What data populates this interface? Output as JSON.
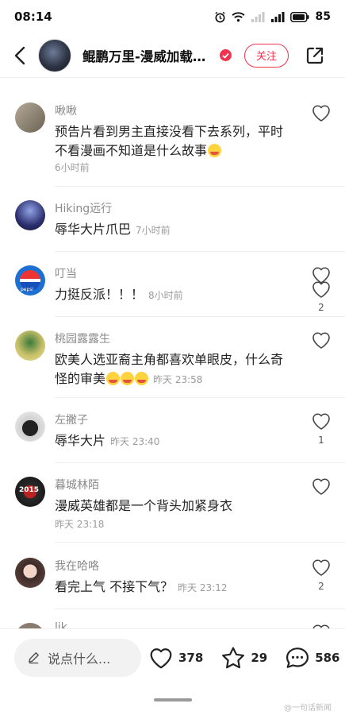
{
  "status_bar": {
    "time": "08:14",
    "battery": "85"
  },
  "header": {
    "title": "鲲鹏万里-漫威加载…",
    "follow_label": "关注"
  },
  "comments": [
    {
      "name": "啾啾",
      "text": "预告片看到男主直接没看下去系列，平时不看漫画不知道是什么故事",
      "time": "6小时前",
      "likes": "",
      "emoji_count": 1
    },
    {
      "name": "Hiking远行",
      "text": "辱华大片爪巴",
      "time": "7小时前",
      "likes": "2",
      "emoji_count": 0
    },
    {
      "name": "叮当",
      "text": "力挺反派！！！",
      "time": "8小时前",
      "likes": "",
      "emoji_count": 0
    },
    {
      "name": "桃园露露生",
      "text": "欧美人选亚裔主角都喜欢单眼皮，什么奇怪的审美",
      "time": "昨天 23:58",
      "likes": "",
      "emoji_count": 3
    },
    {
      "name": "左撇子",
      "text": "辱华大片",
      "time": "昨天 23:40",
      "likes": "1",
      "emoji_count": 0
    },
    {
      "name": "暮城林陌",
      "text": "漫威英雄都是一个背头加紧身衣",
      "time": "昨天 23:18",
      "likes": "",
      "emoji_count": 0
    },
    {
      "name": "我在哈咯",
      "text": "看完上气 不接下气？",
      "time": "昨天 23:12",
      "likes": "2",
      "emoji_count": 0
    },
    {
      "name": "lik",
      "text": "",
      "time": "",
      "likes": "",
      "emoji_count": 0
    }
  ],
  "avatar_labels": {
    "pepsi": "pepsi",
    "year": "2015"
  },
  "bottom_bar": {
    "input_placeholder": "说点什么...",
    "like_count": "378",
    "favorite_count": "29",
    "comment_count": "586"
  },
  "watermark": "@一句话新闻",
  "colors": {
    "accent": "#f0334f",
    "text_primary": "#222222",
    "text_secondary": "#8a8a8a"
  }
}
